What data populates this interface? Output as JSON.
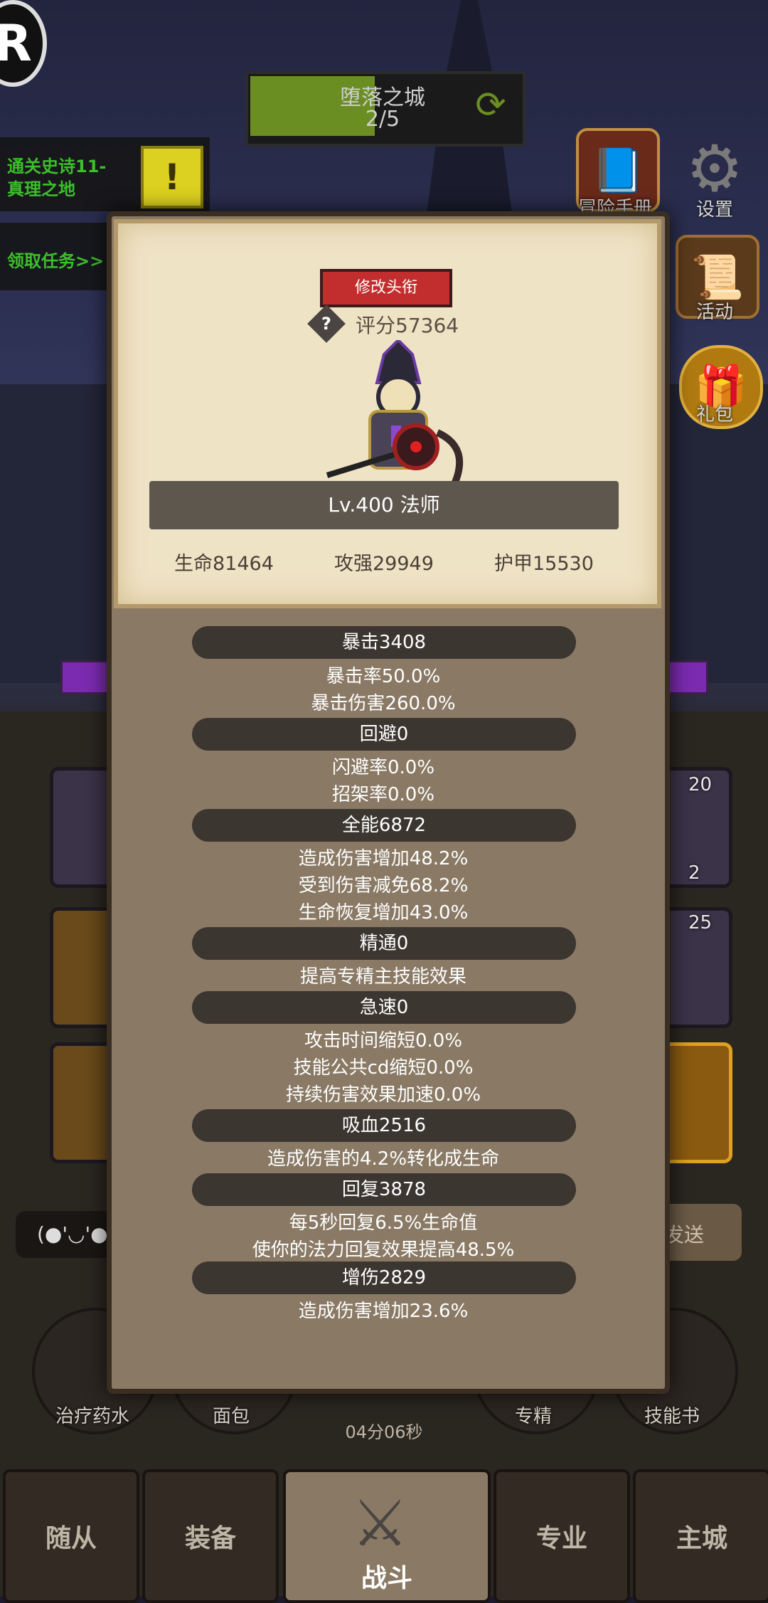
{
  "hud": {
    "logo_letter": "R",
    "stage_name": "堕落之城",
    "stage_progress": "2/5",
    "quest_line1": "通关史诗11-",
    "quest_line2": "真理之地",
    "get_quest": "领取任务>>"
  },
  "side_menu": {
    "adventure_manual": "冒险手册",
    "settings": "设置",
    "activity": "活动",
    "gift": "礼包"
  },
  "panel": {
    "change_title_button": "修改头衔",
    "score": "评分57364",
    "level_class": "Lv.400 法师",
    "hp": "生命81464",
    "attack": "攻强29949",
    "armor": "护甲15530",
    "sections": [
      {
        "title": "暴击3408",
        "lines": [
          "暴击率50.0%",
          "暴击伤害260.0%"
        ]
      },
      {
        "title": "回避0",
        "lines": [
          "闪避率0.0%",
          "招架率0.0%"
        ]
      },
      {
        "title": "全能6872",
        "lines": [
          "造成伤害增加48.2%",
          "受到伤害减免68.2%",
          "生命恢复增加43.0%"
        ]
      },
      {
        "title": "精通0",
        "lines": [
          "提高专精主技能效果"
        ]
      },
      {
        "title": "急速0",
        "lines": [
          "攻击时间缩短0.0%",
          "技能公共cd缩短0.0%",
          "持续伤害效果加速0.0%"
        ]
      },
      {
        "title": "吸血2516",
        "lines": [
          "造成伤害的4.2%转化成生命"
        ]
      },
      {
        "title": "回复3878",
        "lines": [
          "每5秒回复6.5%生命值",
          "使你的法力回复效果提高48.5%"
        ]
      },
      {
        "title": "增伤2829",
        "lines": [
          "造成伤害增加23.6%"
        ]
      }
    ]
  },
  "background": {
    "skill_counts": [
      "20",
      "2",
      "25"
    ],
    "chat_emote": "(●'◡'●",
    "send": "发送",
    "bottom_items": [
      "治疗药水",
      "面包",
      "专精",
      "技能书"
    ],
    "timer": "04分06秒"
  },
  "nav": {
    "followers": "随从",
    "equipment": "装备",
    "battle": "战斗",
    "profession": "专业",
    "main_city": "主城"
  },
  "colors": {
    "accent_red": "#c22e2e",
    "quest_green": "#3cbf2a",
    "stage_bar": "#6b8e23",
    "parchment": "#efe3c5",
    "panel_brown": "#8a7a65"
  }
}
